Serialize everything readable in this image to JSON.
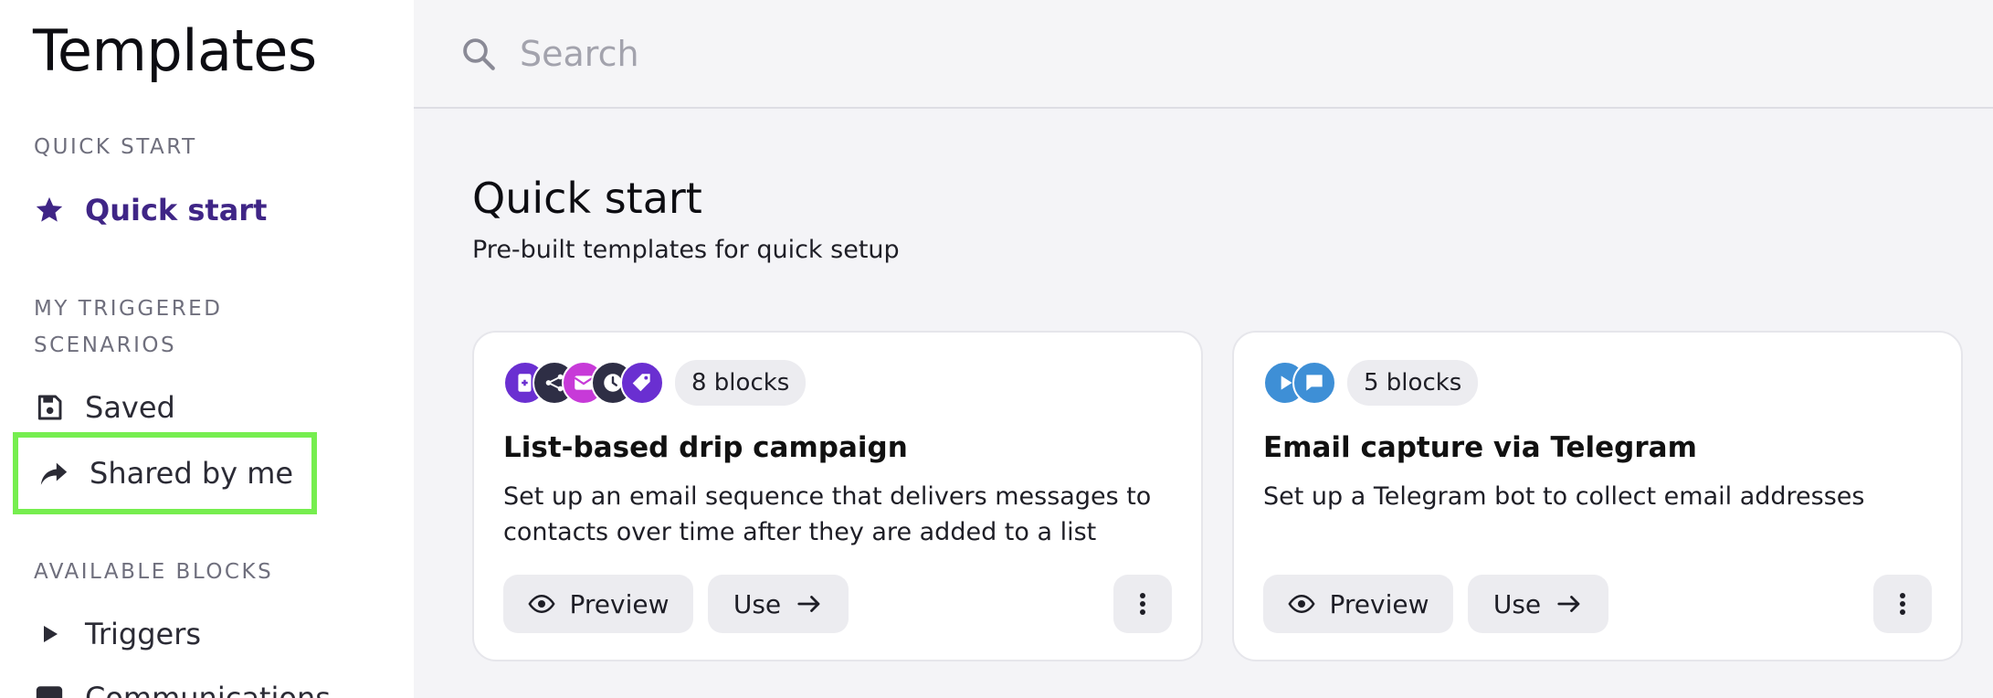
{
  "sidebar": {
    "title": "Templates",
    "sections": {
      "quick_start": "QUICK START",
      "my_triggered": "MY TRIGGERED SCENARIOS",
      "available_blocks": "AVAILABLE BLOCKS"
    },
    "items": {
      "quick_start": {
        "label": "Quick start",
        "icon": "star-icon"
      },
      "saved": {
        "label": "Saved",
        "icon": "save-icon"
      },
      "shared": {
        "label": "Shared by me",
        "icon": "share-arrow-icon"
      },
      "triggers": {
        "label": "Triggers",
        "icon": "play-icon"
      },
      "communications": {
        "label": "Communications",
        "icon": "message-icon"
      }
    },
    "accent_color": "#3f2586",
    "highlight_color": "#76ee4f"
  },
  "search": {
    "placeholder": "Search",
    "value": ""
  },
  "main": {
    "title": "Quick start",
    "subtitle": "Pre-built templates for quick setup",
    "cards": [
      {
        "blocks_label": "8 blocks",
        "icons": [
          "add-contact-icon",
          "branch-icon",
          "email-icon",
          "clock-icon",
          "tag-icon"
        ],
        "title": "List-based drip campaign",
        "description": "Set up an email sequence that delivers messages to contacts over time after they are added to a list",
        "preview_label": "Preview",
        "use_label": "Use"
      },
      {
        "blocks_label": "5 blocks",
        "icons": [
          "play-icon",
          "chat-icon"
        ],
        "title": "Email capture via Telegram",
        "description": "Set up a Telegram bot to collect email addresses",
        "preview_label": "Preview",
        "use_label": "Use"
      }
    ]
  }
}
